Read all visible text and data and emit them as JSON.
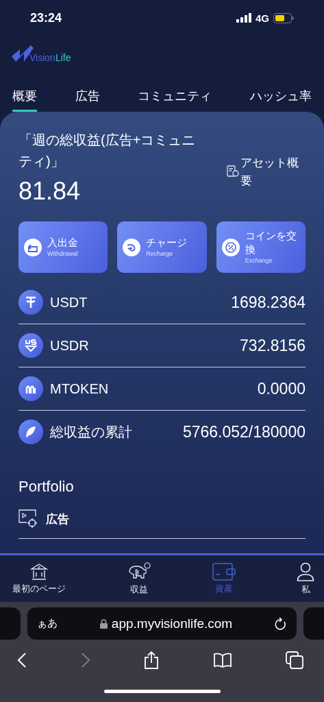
{
  "status_bar": {
    "time": "23:24",
    "network": "4G"
  },
  "logo": {
    "part_1": "Vision",
    "part_2": "Life"
  },
  "tabs": [
    {
      "label": "概要",
      "selected": true
    },
    {
      "label": "広告",
      "selected": false
    },
    {
      "label": "コミュニティ",
      "selected": false
    },
    {
      "label": "ハッシュ率",
      "selected": false
    }
  ],
  "summary": {
    "title": "「週の総収益(広告+コミュニティ)」",
    "value": "81.84",
    "asset_link": "アセット概要"
  },
  "actions": [
    {
      "kind": "withdraw",
      "label": "入出金",
      "sublabel": "Withdrawal"
    },
    {
      "kind": "recharge",
      "label": "チャージ",
      "sublabel": "Recharge"
    },
    {
      "kind": "exchange",
      "label": "コインを交換",
      "sublabel": "Exchange"
    }
  ],
  "assets": [
    {
      "kind": "usdt",
      "name": "USDT",
      "amount": "1698.2364"
    },
    {
      "kind": "usdr",
      "name": "USDR",
      "amount": "732.8156"
    },
    {
      "kind": "mtoken",
      "name": "MTOKEN",
      "amount": "0.0000"
    },
    {
      "kind": "total",
      "name": "総収益の累計",
      "amount": "5766.052/180000"
    }
  ],
  "portfolio": {
    "title": "Portfolio",
    "section": "広告"
  },
  "bottom_nav": [
    {
      "kind": "bank",
      "label": "最初のページ",
      "selected": false
    },
    {
      "kind": "piggy",
      "label": "収益",
      "selected": false
    },
    {
      "kind": "wallet",
      "label": "資産",
      "selected": true
    },
    {
      "kind": "person",
      "label": "私",
      "selected": false
    }
  ],
  "browser": {
    "text_size_button": "ぁあ",
    "url": "app.myvisionlife.com"
  }
}
